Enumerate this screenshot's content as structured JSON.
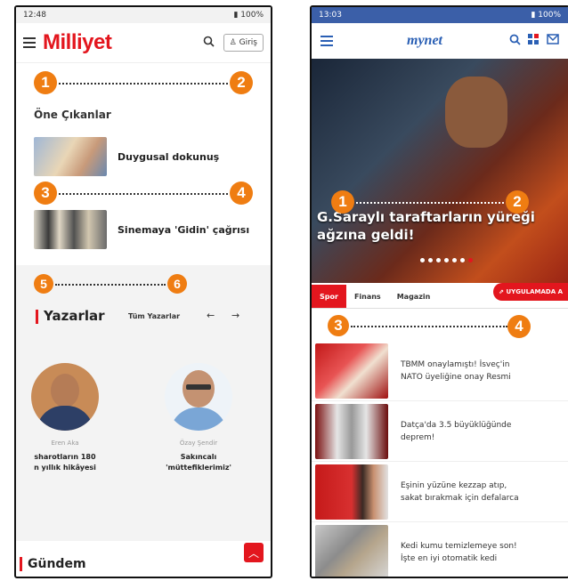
{
  "left_phone": {
    "status": {
      "time": "12:48",
      "battery": "100%"
    },
    "header": {
      "logo": "Milliyet",
      "login_label": "Giriş"
    },
    "markers": [
      "1",
      "2",
      "3",
      "4",
      "5",
      "6"
    ],
    "featured": {
      "title": "Öne Çıkanlar",
      "items": [
        {
          "headline": "Duygusal dokunuş"
        },
        {
          "headline": "Sinemaya 'Gidin' çağrısı"
        }
      ]
    },
    "authors": {
      "title": "Yazarlar",
      "all_label": "Tüm Yazarlar",
      "prev": "←",
      "next": "→",
      "items": [
        {
          "name": "Eren Aka",
          "title_line1": "sharotların 180",
          "title_line2": "n yıllık hikâyesi"
        },
        {
          "name": "Özay Şendir",
          "title_line1": "Sakıncalı",
          "title_line2": "'müttefiklerimiz'"
        }
      ]
    },
    "gundem": {
      "title": "Gündem"
    }
  },
  "right_phone": {
    "status": {
      "time": "13:03",
      "battery": "100%"
    },
    "header": {
      "logo": "mynet"
    },
    "markers": [
      "1",
      "2",
      "3",
      "4"
    ],
    "hero": {
      "headline_line1": "G.Saraylı taraftarların yüreği",
      "headline_line2": "ağzına geldi!"
    },
    "tabs": [
      "Spor",
      "Finans",
      "Magazin"
    ],
    "app_button": "UYGULAMADA A",
    "news": [
      {
        "line1": "TBMM onaylamıştı! İsveç'in",
        "line2": "NATO üyeliğine onay Resmi"
      },
      {
        "line1": "Datça'da 3.5 büyüklüğünde",
        "line2": "deprem!"
      },
      {
        "line1": "Eşinin yüzüne kezzap atıp,",
        "line2": "sakat bırakmak için defalarca"
      },
      {
        "line1": "Kedi kumu temizlemeye son!",
        "line2": "İşte en iyi otomatik kedi"
      }
    ]
  },
  "colors": {
    "marker": "#ef7d12",
    "accent_red": "#e3161e",
    "mynet_blue": "#2a5fb4"
  }
}
